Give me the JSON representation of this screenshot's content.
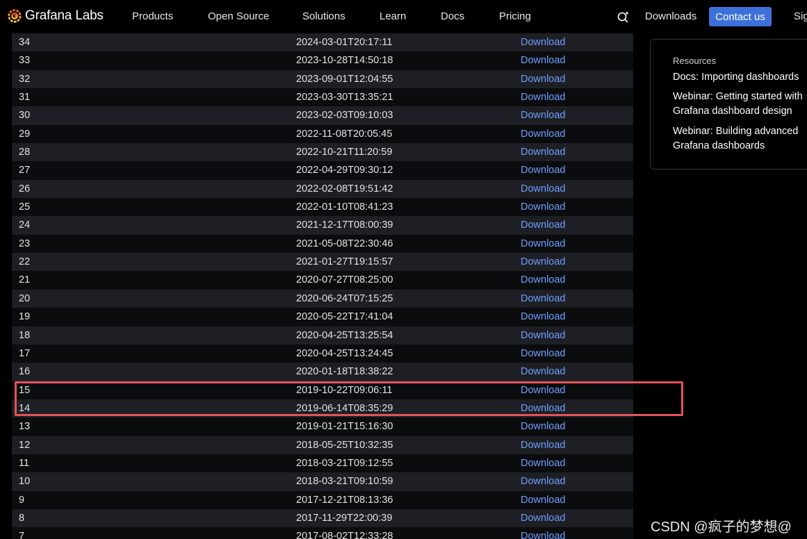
{
  "nav": {
    "brand": "Grafana Labs",
    "items": [
      "Products",
      "Open Source",
      "Solutions",
      "Learn",
      "Docs",
      "Pricing"
    ],
    "downloads": "Downloads",
    "contact": "Contact us",
    "sign": "Sig"
  },
  "table": {
    "rows": [
      {
        "version": "34",
        "date": "2024-03-01T20:17:11",
        "link": "Download"
      },
      {
        "version": "33",
        "date": "2023-10-28T14:50:18",
        "link": "Download"
      },
      {
        "version": "32",
        "date": "2023-09-01T12:04:55",
        "link": "Download"
      },
      {
        "version": "31",
        "date": "2023-03-30T13:35:21",
        "link": "Download"
      },
      {
        "version": "30",
        "date": "2023-02-03T09:10:03",
        "link": "Download"
      },
      {
        "version": "29",
        "date": "2022-11-08T20:05:45",
        "link": "Download"
      },
      {
        "version": "28",
        "date": "2022-10-21T11:20:59",
        "link": "Download"
      },
      {
        "version": "27",
        "date": "2022-04-29T09:30:12",
        "link": "Download"
      },
      {
        "version": "26",
        "date": "2022-02-08T19:51:42",
        "link": "Download"
      },
      {
        "version": "25",
        "date": "2022-01-10T08:41:23",
        "link": "Download"
      },
      {
        "version": "24",
        "date": "2021-12-17T08:00:39",
        "link": "Download"
      },
      {
        "version": "23",
        "date": "2021-05-08T22:30:46",
        "link": "Download"
      },
      {
        "version": "22",
        "date": "2021-01-27T19:15:57",
        "link": "Download"
      },
      {
        "version": "21",
        "date": "2020-07-27T08:25:00",
        "link": "Download"
      },
      {
        "version": "20",
        "date": "2020-06-24T07:15:25",
        "link": "Download"
      },
      {
        "version": "19",
        "date": "2020-05-22T17:41:04",
        "link": "Download"
      },
      {
        "version": "18",
        "date": "2020-04-25T13:25:54",
        "link": "Download"
      },
      {
        "version": "17",
        "date": "2020-04-25T13:24:45",
        "link": "Download"
      },
      {
        "version": "16",
        "date": "2020-01-18T18:38:22",
        "link": "Download"
      },
      {
        "version": "15",
        "date": "2019-10-22T09:06:11",
        "link": "Download"
      },
      {
        "version": "14",
        "date": "2019-06-14T08:35:29",
        "link": "Download"
      },
      {
        "version": "13",
        "date": "2019-01-21T15:16:30",
        "link": "Download"
      },
      {
        "version": "12",
        "date": "2018-05-25T10:32:35",
        "link": "Download"
      },
      {
        "version": "11",
        "date": "2018-03-21T09:12:55",
        "link": "Download"
      },
      {
        "version": "10",
        "date": "2018-03-21T09:10:59",
        "link": "Download"
      },
      {
        "version": "9",
        "date": "2017-12-21T08:13:36",
        "link": "Download"
      },
      {
        "version": "8",
        "date": "2017-11-29T22:00:39",
        "link": "Download"
      },
      {
        "version": "7",
        "date": "2017-08-02T12:33:28",
        "link": "Download"
      }
    ]
  },
  "resources": {
    "heading": "Resources",
    "links": [
      "Docs: Importing dashboards",
      "Webinar: Getting started with Grafana dashboard design",
      "Webinar: Building advanced Grafana dashboards"
    ]
  },
  "watermark": "CSDN @疯子的梦想@",
  "colors": {
    "accent": "#3d71d9",
    "link": "#6e9fff",
    "highlight": "#e5535b",
    "row_odd": "#1e1f24",
    "row_even": "#0b0c0e"
  }
}
